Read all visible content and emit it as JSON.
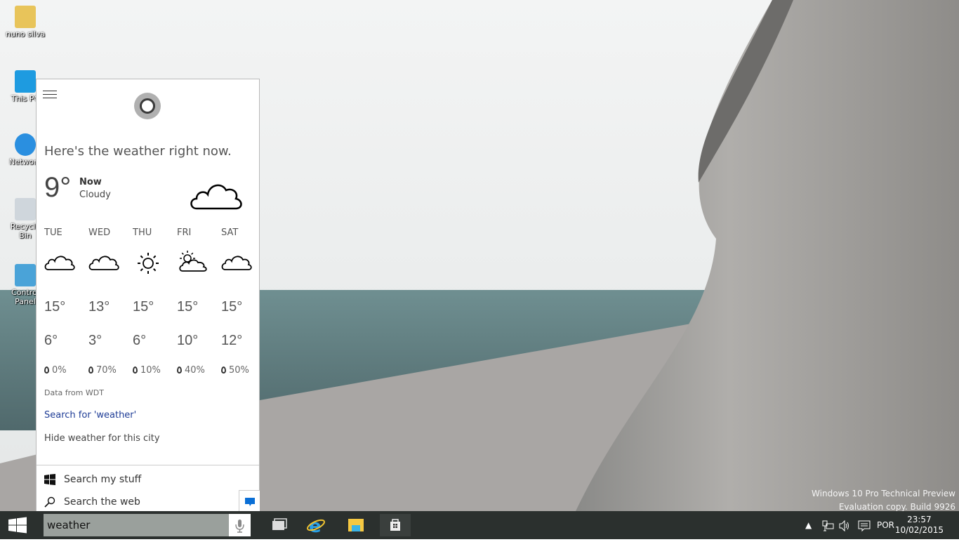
{
  "desktop": {
    "icons": [
      {
        "label": "nuno silva",
        "icon": "user-folder-icon"
      },
      {
        "label": "This PC",
        "icon": "computer-icon"
      },
      {
        "label": "Network",
        "icon": "network-icon"
      },
      {
        "label": "Recycle Bin",
        "icon": "recycle-bin-icon"
      },
      {
        "label": "Control Panel",
        "icon": "control-panel-icon"
      }
    ],
    "watermark": {
      "line1": "Windows 10 Pro Technical Preview",
      "line2": "Evaluation copy. Build 9926"
    }
  },
  "cortana": {
    "headline": "Here's the weather right now.",
    "current": {
      "temp": "9°",
      "label": "Now",
      "condition": "Cloudy",
      "icon": "cloud-icon"
    },
    "forecast": [
      {
        "day": "TUE",
        "icon": "cloud",
        "high": "15°",
        "low": "6°",
        "rain": "0%"
      },
      {
        "day": "WED",
        "icon": "cloud",
        "high": "13°",
        "low": "3°",
        "rain": "70%"
      },
      {
        "day": "THU",
        "icon": "sun",
        "high": "15°",
        "low": "6°",
        "rain": "10%"
      },
      {
        "day": "FRI",
        "icon": "partly-sunny",
        "high": "15°",
        "low": "10°",
        "rain": "40%"
      },
      {
        "day": "SAT",
        "icon": "cloud",
        "high": "15°",
        "low": "12°",
        "rain": "50%"
      }
    ],
    "source": "Data from WDT",
    "search_link": "Search for 'weather'",
    "hide_link": "Hide weather for this city",
    "search_my_stuff": "Search my stuff",
    "search_web": "Search the web"
  },
  "taskbar": {
    "search_value": "weather",
    "language": "POR",
    "time": "23:57",
    "date": "10/02/2015"
  },
  "colors": {
    "taskbar": "#2b302e",
    "link": "#1e3c96",
    "feedback": "#0a6fd6"
  }
}
